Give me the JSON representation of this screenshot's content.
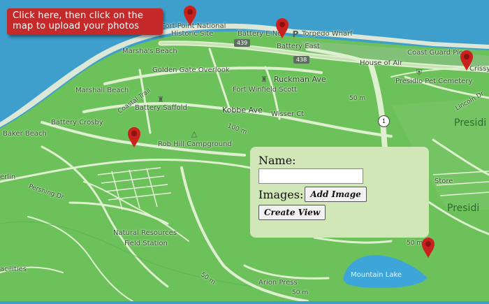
{
  "banner": {
    "line1": "Click here, then click on the",
    "line2": "map to upload your photos"
  },
  "form": {
    "name_label": "Name:",
    "name_value": "",
    "images_label": "Images:",
    "add_image_label": "Add Image",
    "create_view_label": "Create View"
  },
  "labels": {
    "fort_point": "Fort Point National",
    "historic_site": "Historic Site",
    "battery_e": "Battery E No.",
    "torpedo_wharf": "Torpedo Wharf",
    "battery_east": "Battery East",
    "marshas_beach": "Marsha's Beach",
    "golden_gate_overlook": "Golden Gate Overlook",
    "ruckman_ave": "Ruckman Ave",
    "fort_winfield_scott": "Fort Winfield Scott",
    "house_of_air": "House of Air",
    "coast_guard_pier": "Coast Guard Pier",
    "presidio_pet_cemetery": "Presidio Pet Cemetery",
    "crissy": "Crissy",
    "marshall_beach": "Marshall Beach",
    "coastal_trail": "Coastal Trail",
    "battery_saffold": "Battery Saffold",
    "kobbe_ave": "Kobbe Ave",
    "wisser_ct": "Wisser Ct",
    "battery_crosby": "Battery Crosby",
    "baker_beach": "Baker Beach",
    "rob_hill_campground": "Rob Hill Campground",
    "lincoln_dr": "Lincoln Dr",
    "presidio_1": "Presidi",
    "presidio_2": "Presidi",
    "store": "Store",
    "pershing_dr": "Pershing Dr",
    "erlin": "erlin",
    "natural_resources": "Natural Resources",
    "field_station": "Field Station",
    "mountain_lake": "Mountain Lake",
    "arion_press": "Arion Press",
    "acilities": "acilities",
    "meters_50_a": "50 m",
    "meters_100": "100 m",
    "meters_50_b": "50 m",
    "meters_50_c": "50 m",
    "meters_50_d": "50 m"
  },
  "shields": {
    "hwy_439": "439",
    "hwy_438": "438",
    "route_1": "1"
  },
  "colors": {
    "water": "#3e9fcc",
    "land": "#6cc15a",
    "road": "#dff0d0",
    "pin": "#c8211e",
    "banner": "#c42a2a",
    "form_bg": "#d2e7b7",
    "lake": "#3ea5d8"
  },
  "icons": [
    "map-marker-icon",
    "parking-icon",
    "campground-icon",
    "fort-icon",
    "cemetery-icon",
    "beach-umbrella-icon"
  ]
}
